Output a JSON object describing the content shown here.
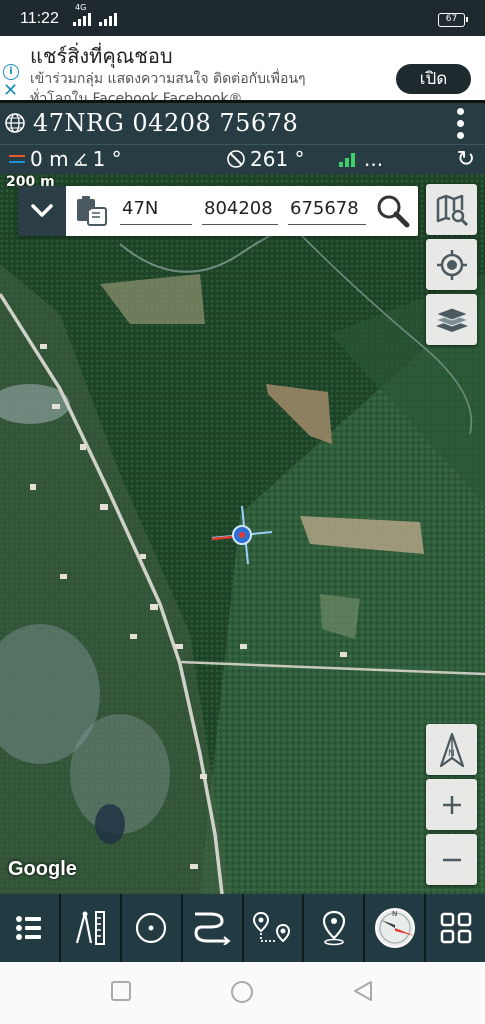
{
  "status_bar": {
    "time": "11:22",
    "network": "4G",
    "battery": "67"
  },
  "ad": {
    "title": "แชร์สิ่งที่คุณชอบ",
    "description": "เข้าร่วมกลุ่ม แสดงความสนใจ ติดต่อกับเพื่อนๆ",
    "description_cut": "ทั่วโลกใน Facebook Facebook®",
    "open_label": "เปิด"
  },
  "coord_header": {
    "grid_code": "47NRG 04208 75678"
  },
  "info_bar": {
    "distance": "0 m",
    "angle": "1 °",
    "bearing": "261 °",
    "satellite": "..."
  },
  "map": {
    "scale_label": "200 m",
    "attribution": "Google"
  },
  "search": {
    "zone": "47N",
    "easting": "804208",
    "northing": "675678"
  },
  "map_buttons": [
    "map-search",
    "my-location",
    "layers"
  ],
  "zoom_buttons": [
    "north-up",
    "zoom-in",
    "zoom-out"
  ],
  "toolbar": {
    "items": [
      "menu",
      "measure",
      "circle",
      "track",
      "route",
      "waypoint",
      "compass",
      "grid"
    ]
  },
  "colors": {
    "toolbar": "#223a41",
    "header": "#273c43",
    "accent": "#e23a30"
  }
}
